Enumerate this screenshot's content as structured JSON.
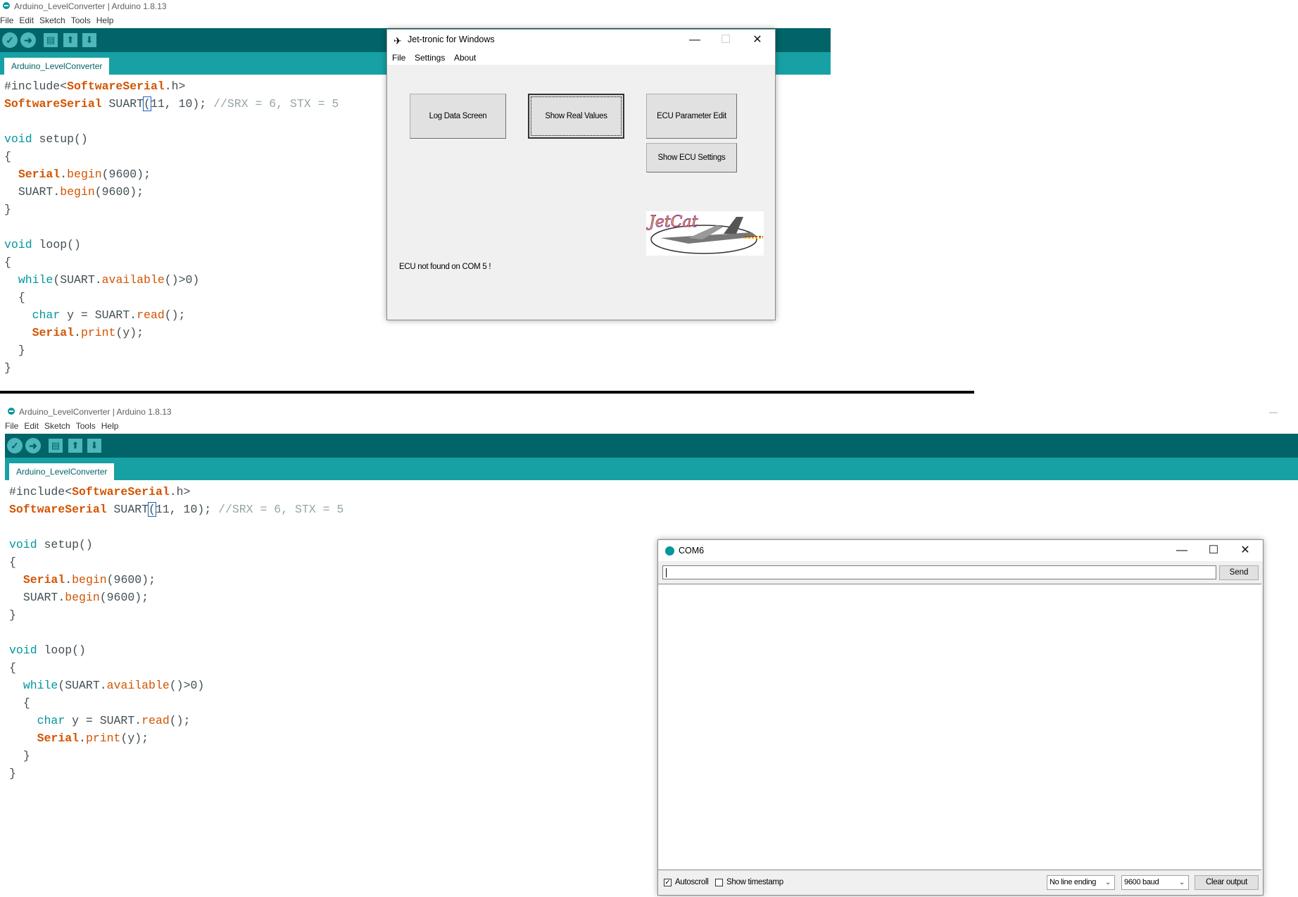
{
  "ide": {
    "title": "Arduino_LevelConverter | Arduino 1.8.13",
    "menu": [
      "File",
      "Edit",
      "Sketch",
      "Tools",
      "Help"
    ],
    "tab": "Arduino_LevelConverter",
    "toolbar_icons": [
      "verify-icon",
      "upload-icon",
      "new-icon",
      "open-icon",
      "save-icon"
    ]
  },
  "code": {
    "l1_pre": "#include<",
    "l1_cls": "SoftwareSerial",
    "l1_post": ".h>",
    "l2_cls": "SoftwareSerial",
    "l2_a": " SUART",
    "l2_paren": "(",
    "l2_b": "11, 10); ",
    "l2_cm": "//SRX = 6, STX = 5",
    "l4_kw": "void",
    "l4_fn": " setup()",
    "l5": "{",
    "l6_cls": "Serial",
    "l6_dot": ".",
    "l6_fn": "begin",
    "l6_rest": "(9600);",
    "l7_a": "SUART.",
    "l7_fn": "begin",
    "l7_rest": "(9600);",
    "l8": "}",
    "l10_kw": "void",
    "l10_fn": " loop()",
    "l11": "{",
    "l12_kw": "while",
    "l12_a": "(SUART.",
    "l12_fn": "available",
    "l12_rest": "()>0)",
    "l13": "{",
    "l14_kw": "char",
    "l14_a": " y = SUART.",
    "l14_fn": "read",
    "l14_rest": "();",
    "l15_cls": "Serial",
    "l15_dot": ".",
    "l15_fn": "print",
    "l15_rest": "(y);",
    "l16": "}",
    "l17": "}"
  },
  "jettronic": {
    "title": "Jet-tronic for Windows",
    "menu": [
      "File",
      "Settings",
      "About"
    ],
    "buttons": {
      "log": "Log Data Screen",
      "real": "Show Real Values",
      "param": "ECU Parameter Edit",
      "settings": "Show ECU Settings"
    },
    "status": "ECU not found on COM 5 !",
    "logo_text": "JetCat"
  },
  "com": {
    "title": "COM6",
    "input_value": "",
    "send": "Send",
    "autoscroll": {
      "label": "Autoscroll",
      "checked": true
    },
    "timestamp": {
      "label": "Show timestamp",
      "checked": false
    },
    "line_ending": "No line ending",
    "baud": "9600 baud",
    "clear": "Clear output"
  }
}
